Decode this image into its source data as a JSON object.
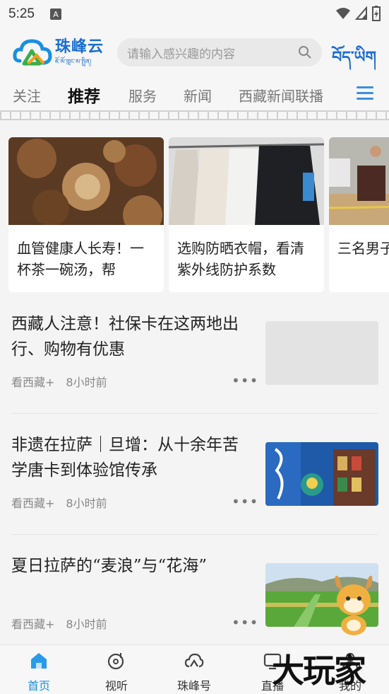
{
  "status_bar": {
    "time": "5:25",
    "indicator": "A"
  },
  "header": {
    "logo_cn": "珠峰云",
    "logo_tib": "ཇོ་མོ་གླང་མ་སྤྲིན།",
    "search_placeholder": "请输入感兴趣的内容",
    "tibetan_button": "བོད་ཡིག"
  },
  "tabs": [
    {
      "label": "关注"
    },
    {
      "label": "推荐"
    },
    {
      "label": "服务"
    },
    {
      "label": "新闻"
    },
    {
      "label": "西藏新闻联播"
    }
  ],
  "active_tab": "推荐",
  "cards": [
    {
      "title": "血管健康人长寿！一杯茶一碗汤，帮"
    },
    {
      "title": "选购防晒衣帽，看清紫外线防护系数"
    },
    {
      "title": "三名男子车数百米"
    }
  ],
  "news": [
    {
      "title": "西藏人注意！社保卡在这两地出行、购物有优惠",
      "source": "看西藏+",
      "time": "8小时前"
    },
    {
      "title": "非遗在拉萨｜旦增：从十余年苦学唐卡到体验馆传承",
      "source": "看西藏+",
      "time": "8小时前"
    },
    {
      "title": "夏日拉萨的“麦浪”与“花海”",
      "source": "看西藏+",
      "time": "8小时前"
    }
  ],
  "more_glyph": "•••",
  "bottom_nav": [
    {
      "label": "首页"
    },
    {
      "label": "视听"
    },
    {
      "label": "珠峰号"
    },
    {
      "label": "直播"
    },
    {
      "label": "我的"
    }
  ],
  "watermark": "大玩家",
  "colors": {
    "accent": "#1a6ed0",
    "active_nav": "#1a8fe0"
  }
}
